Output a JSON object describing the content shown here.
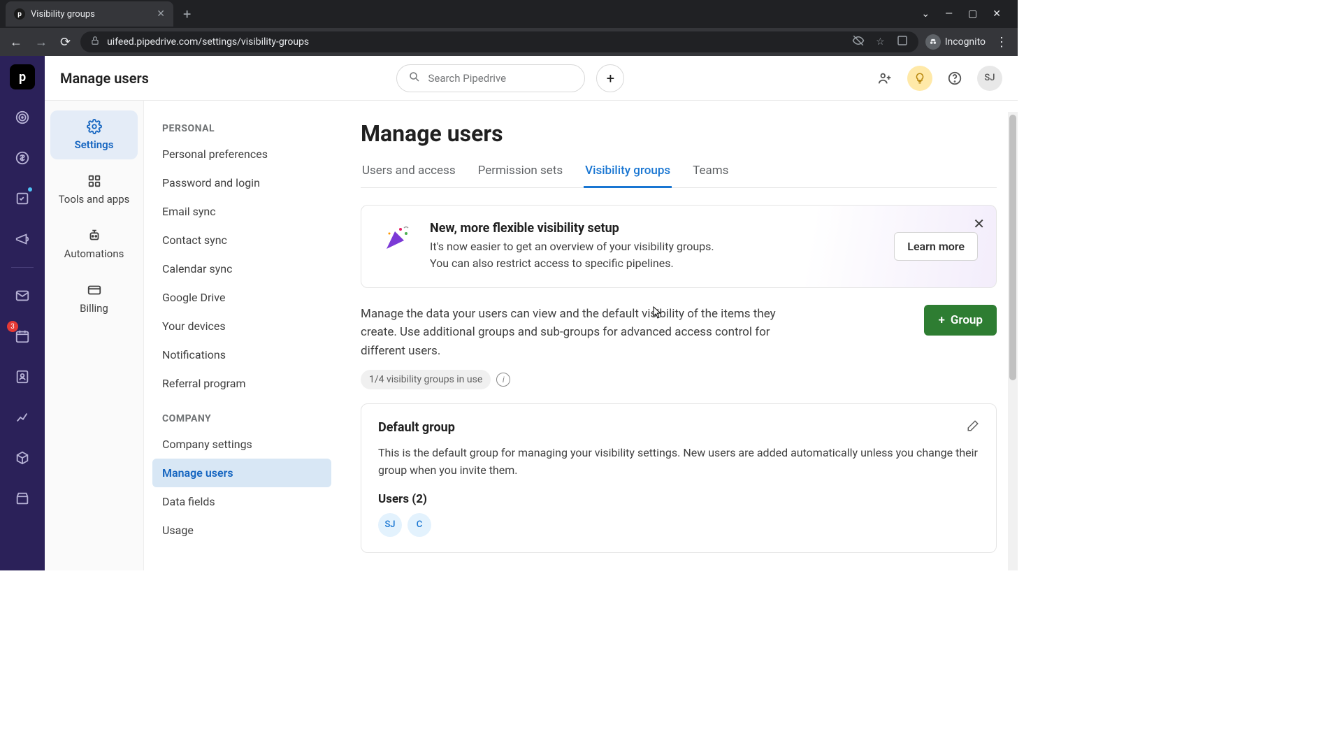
{
  "browser": {
    "tab_title": "Visibility groups",
    "url": "uifeed.pipedrive.com/settings/visibility-groups",
    "incognito_label": "Incognito"
  },
  "topbar": {
    "page": "Manage users",
    "search_placeholder": "Search Pipedrive",
    "avatar": "SJ"
  },
  "rail_badge": "3",
  "col1": {
    "settings": "Settings",
    "tools": "Tools and apps",
    "automations": "Automations",
    "billing": "Billing"
  },
  "personal": {
    "heading": "PERSONAL",
    "items": [
      "Personal preferences",
      "Password and login",
      "Email sync",
      "Contact sync",
      "Calendar sync",
      "Google Drive",
      "Your devices",
      "Notifications",
      "Referral program"
    ]
  },
  "company": {
    "heading": "COMPANY",
    "items": [
      "Company settings",
      "Manage users",
      "Data fields",
      "Usage"
    ]
  },
  "main": {
    "title": "Manage users",
    "tabs": [
      "Users and access",
      "Permission sets",
      "Visibility groups",
      "Teams"
    ],
    "active_tab_index": 2,
    "notice": {
      "title": "New, more flexible visibility setup",
      "text": "It's now easier to get an overview of your visibility groups. You can also restrict access to specific pipelines.",
      "learn_more": "Learn more"
    },
    "description": "Manage the data your users can view and the default visibility of the items they create. Use additional groups and sub-groups for advanced access control for different users.",
    "group_button": "Group",
    "usage_badge": "1/4 visibility groups in use",
    "default_group": {
      "title": "Default group",
      "desc": "This is the default group for managing your visibility settings. New users are added automatically unless you change their group when you invite them.",
      "users_label": "Users (2)",
      "avatars": [
        "SJ",
        "C"
      ]
    }
  }
}
